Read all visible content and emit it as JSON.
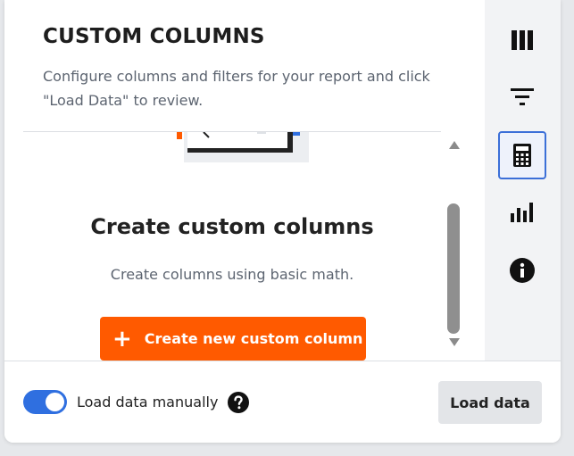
{
  "panel": {
    "title": "CUSTOM COLUMNS",
    "description": "Configure columns and filters for your report and click \"Load Data\" to review."
  },
  "empty_state": {
    "heading": "Create custom columns",
    "subtext": "Create columns using basic math.",
    "create_button": {
      "icon": "+",
      "label": "Create new custom column"
    }
  },
  "footer": {
    "toggle_label": "Load data manually",
    "toggle_on": true,
    "help_icon": "question-circle-icon",
    "load_button_label": "Load data"
  },
  "rail": {
    "items": [
      {
        "icon": "columns-icon",
        "active": false
      },
      {
        "icon": "filter-icon",
        "active": false
      },
      {
        "icon": "calculator-icon",
        "active": true
      },
      {
        "icon": "bar-chart-icon",
        "active": false
      },
      {
        "icon": "info-icon",
        "active": false
      }
    ]
  },
  "colors": {
    "accent_orange": "#ff5a00",
    "toggle_blue": "#2f6fe0",
    "active_border": "#3b6fd8"
  }
}
